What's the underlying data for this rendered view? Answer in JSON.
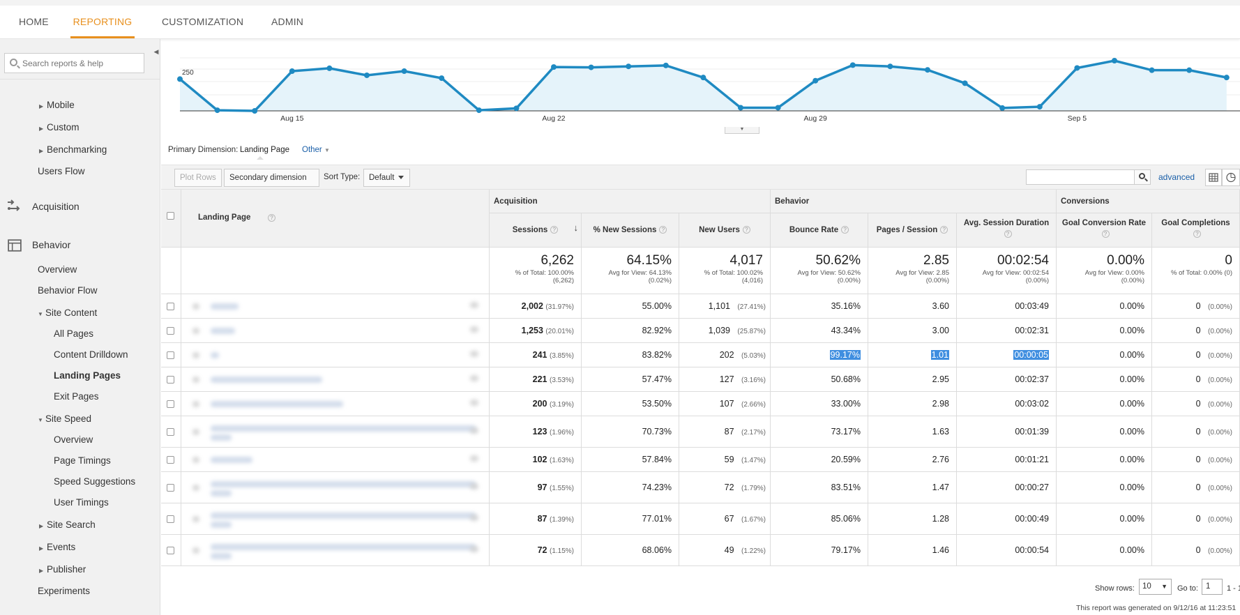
{
  "nav": {
    "tabs": [
      "HOME",
      "REPORTING",
      "CUSTOMIZATION",
      "ADMIN"
    ],
    "active": "REPORTING"
  },
  "sidebar": {
    "search_placeholder": "Search reports & help",
    "items": [
      {
        "label": "Mobile",
        "arrow": "right"
      },
      {
        "label": "Custom",
        "arrow": "right"
      },
      {
        "label": "Benchmarking",
        "arrow": "right"
      },
      {
        "label": "Users Flow"
      },
      {
        "label": "Acquisition"
      },
      {
        "label": "Behavior"
      },
      {
        "label": "Overview"
      },
      {
        "label": "Behavior Flow"
      },
      {
        "label": "Site Content",
        "arrow": "down"
      },
      {
        "label": "All Pages"
      },
      {
        "label": "Content Drilldown"
      },
      {
        "label": "Landing Pages"
      },
      {
        "label": "Exit Pages"
      },
      {
        "label": "Site Speed",
        "arrow": "down"
      },
      {
        "label": "Overview"
      },
      {
        "label": "Page Timings"
      },
      {
        "label": "Speed Suggestions"
      },
      {
        "label": "User Timings"
      },
      {
        "label": "Site Search",
        "arrow": "right"
      },
      {
        "label": "Events",
        "arrow": "right"
      },
      {
        "label": "Publisher",
        "arrow": "right"
      },
      {
        "label": "Experiments"
      }
    ]
  },
  "chart_data": {
    "type": "line",
    "series": [
      {
        "values": [
          250,
          152,
          150,
          275,
          284,
          262,
          275,
          253,
          152,
          158,
          288,
          287,
          290,
          293,
          255,
          160,
          160,
          245,
          294,
          290,
          279,
          237,
          159,
          163,
          285,
          308,
          278,
          278,
          255
        ]
      }
    ],
    "x_tick_labels": [
      "Aug 15",
      "Aug 22",
      "Aug 29",
      "Sep 5"
    ],
    "y_label_value": "250",
    "color": "#1f8ac2"
  },
  "primary_dimension": {
    "label": "Primary Dimension:",
    "value": "Landing Page",
    "other": "Other"
  },
  "toolbar": {
    "plot_rows": "Plot Rows",
    "secondary_dimension": "Secondary dimension",
    "sort_type_label": "Sort Type:",
    "sort_type_value": "Default",
    "advanced": "advanced"
  },
  "table": {
    "groups": [
      "Acquisition",
      "Behavior",
      "Conversions"
    ],
    "landing_col": "Landing Page",
    "columns": [
      "Sessions",
      "% New Sessions",
      "New Users",
      "Bounce Rate",
      "Pages / Session",
      "Avg. Session Duration",
      "Goal Conversion Rate",
      "Goal Completions"
    ],
    "totals": [
      {
        "main": "6,262",
        "sub1": "% of Total: 100.00%",
        "sub2": "(6,262)"
      },
      {
        "main": "64.15%",
        "sub1": "Avg for View: 64.13%",
        "sub2": "(0.02%)"
      },
      {
        "main": "4,017",
        "sub1": "% of Total: 100.02%",
        "sub2": "(4,016)"
      },
      {
        "main": "50.62%",
        "sub1": "Avg for View: 50.62%",
        "sub2": "(0.00%)"
      },
      {
        "main": "2.85",
        "sub1": "Avg for View: 2.85",
        "sub2": "(0.00%)"
      },
      {
        "main": "00:02:54",
        "sub1": "Avg for View: 00:02:54",
        "sub2": "(0.00%)"
      },
      {
        "main": "0.00%",
        "sub1": "Avg for View: 0.00%",
        "sub2": "(0.00%)"
      },
      {
        "main": "0",
        "sub1": "% of Total: 0.00% (0)",
        "sub2": ""
      }
    ],
    "rows": [
      {
        "sessions": "2,002",
        "sessions_pct": "(31.97%)",
        "new_sessions": "55.00%",
        "new_users": "1,101",
        "new_users_pct": "(27.41%)",
        "bounce": "35.16%",
        "pages": "3.60",
        "duration": "00:03:49",
        "gcr": "0.00%",
        "gc": "0",
        "gc_pct": "(0.00%)"
      },
      {
        "sessions": "1,253",
        "sessions_pct": "(20.01%)",
        "new_sessions": "82.92%",
        "new_users": "1,039",
        "new_users_pct": "(25.87%)",
        "bounce": "43.34%",
        "pages": "3.00",
        "duration": "00:02:31",
        "gcr": "0.00%",
        "gc": "0",
        "gc_pct": "(0.00%)"
      },
      {
        "sessions": "241",
        "sessions_pct": "(3.85%)",
        "new_sessions": "83.82%",
        "new_users": "202",
        "new_users_pct": "(5.03%)",
        "bounce": "99.17%",
        "pages": "1.01",
        "duration": "00:00:05",
        "gcr": "0.00%",
        "gc": "0",
        "gc_pct": "(0.00%)"
      },
      {
        "sessions": "221",
        "sessions_pct": "(3.53%)",
        "new_sessions": "57.47%",
        "new_users": "127",
        "new_users_pct": "(3.16%)",
        "bounce": "50.68%",
        "pages": "2.95",
        "duration": "00:02:37",
        "gcr": "0.00%",
        "gc": "0",
        "gc_pct": "(0.00%)"
      },
      {
        "sessions": "200",
        "sessions_pct": "(3.19%)",
        "new_sessions": "53.50%",
        "new_users": "107",
        "new_users_pct": "(2.66%)",
        "bounce": "33.00%",
        "pages": "2.98",
        "duration": "00:03:02",
        "gcr": "0.00%",
        "gc": "0",
        "gc_pct": "(0.00%)"
      },
      {
        "sessions": "123",
        "sessions_pct": "(1.96%)",
        "new_sessions": "70.73%",
        "new_users": "87",
        "new_users_pct": "(2.17%)",
        "bounce": "73.17%",
        "pages": "1.63",
        "duration": "00:01:39",
        "gcr": "0.00%",
        "gc": "0",
        "gc_pct": "(0.00%)"
      },
      {
        "sessions": "102",
        "sessions_pct": "(1.63%)",
        "new_sessions": "57.84%",
        "new_users": "59",
        "new_users_pct": "(1.47%)",
        "bounce": "20.59%",
        "pages": "2.76",
        "duration": "00:01:21",
        "gcr": "0.00%",
        "gc": "0",
        "gc_pct": "(0.00%)"
      },
      {
        "sessions": "97",
        "sessions_pct": "(1.55%)",
        "new_sessions": "74.23%",
        "new_users": "72",
        "new_users_pct": "(1.79%)",
        "bounce": "83.51%",
        "pages": "1.47",
        "duration": "00:00:27",
        "gcr": "0.00%",
        "gc": "0",
        "gc_pct": "(0.00%)"
      },
      {
        "sessions": "87",
        "sessions_pct": "(1.39%)",
        "new_sessions": "77.01%",
        "new_users": "67",
        "new_users_pct": "(1.67%)",
        "bounce": "85.06%",
        "pages": "1.28",
        "duration": "00:00:49",
        "gcr": "0.00%",
        "gc": "0",
        "gc_pct": "(0.00%)"
      },
      {
        "sessions": "72",
        "sessions_pct": "(1.15%)",
        "new_sessions": "68.06%",
        "new_users": "49",
        "new_users_pct": "(1.22%)",
        "bounce": "79.17%",
        "pages": "1.46",
        "duration": "00:00:54",
        "gcr": "0.00%",
        "gc": "0",
        "gc_pct": "(0.00%)"
      }
    ]
  },
  "footer": {
    "show_rows_label": "Show rows:",
    "show_rows_value": "10",
    "goto_label": "Go to:",
    "goto_value": "1",
    "range": "1 - 1",
    "generated": "This report was generated on 9/12/16 at 11:23:51"
  }
}
